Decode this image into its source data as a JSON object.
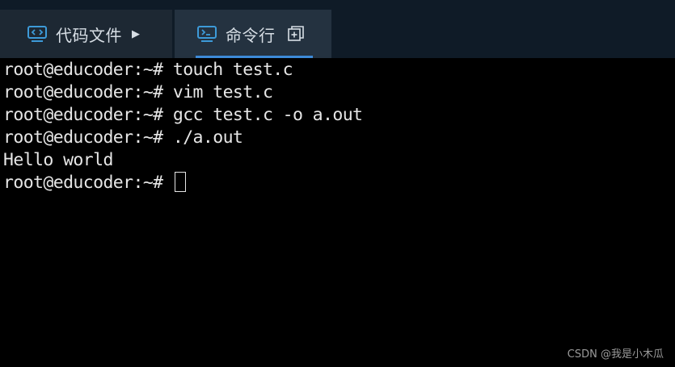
{
  "tabs": {
    "code": {
      "label": "代码文件",
      "arrow": "▶",
      "icon": "code-monitor-icon"
    },
    "terminal": {
      "label": "命令行",
      "icon": "terminal-monitor-icon",
      "action_icon": "new-window-icon",
      "accent": "#3d8ad8"
    }
  },
  "terminal": {
    "lines": [
      "root@educoder:~# touch test.c",
      "root@educoder:~# vim test.c",
      "root@educoder:~# gcc test.c -o a.out",
      "root@educoder:~# ./a.out",
      "Hello world"
    ],
    "prompt": "root@educoder:~# "
  },
  "watermark": "CSDN @我是小木瓜"
}
